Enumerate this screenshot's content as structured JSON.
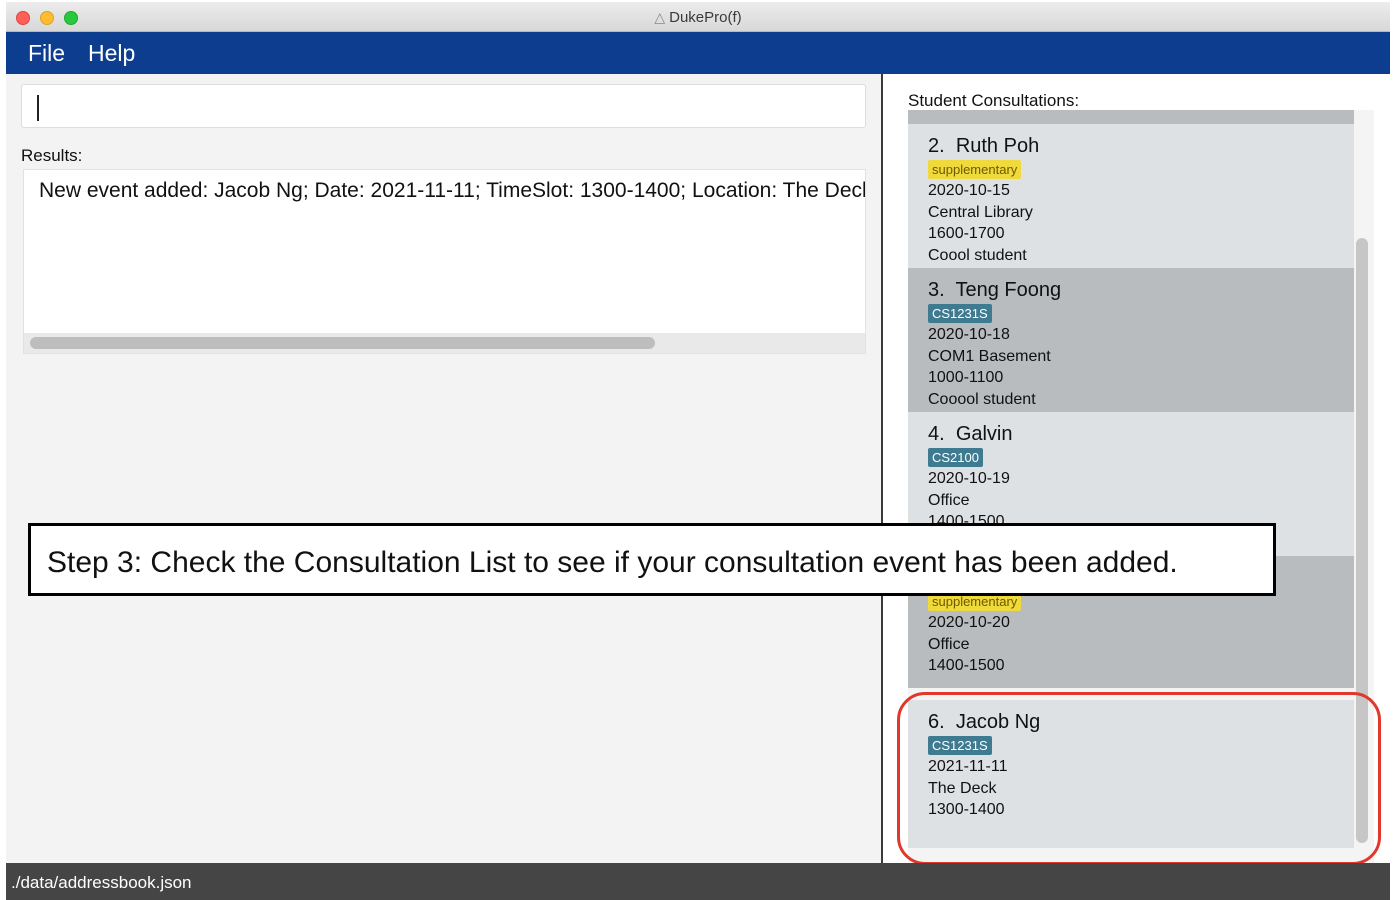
{
  "window": {
    "title": "DukePro(f)",
    "icon": "java-app-icon"
  },
  "menu": {
    "file": "File",
    "help": "Help"
  },
  "command": {
    "value": ""
  },
  "results": {
    "label": "Results:",
    "text": "New event added: Jacob Ng; Date: 2021-11-11; TimeSlot: 1300-1400; Location: The Deck"
  },
  "consultations": {
    "label": "Student Consultations:",
    "items": [
      {
        "index": "2.",
        "name": "Ruth Poh",
        "tag": "supplementary",
        "tag_color": "#f0d93a",
        "date": "2020-10-15",
        "location": "Central Library",
        "time": "1600-1700",
        "remark": "Coool student"
      },
      {
        "index": "3.",
        "name": "Teng Foong",
        "tag": "CS1231S",
        "tag_color": "#3e7b91",
        "date": "2020-10-18",
        "location": "COM1 Basement",
        "time": "1000-1100",
        "remark": "Cooool student"
      },
      {
        "index": "4.",
        "name": "Galvin",
        "tag": "CS2100",
        "tag_color": "#3e7b91",
        "date": "2020-10-19",
        "location": "Office",
        "time": "1400-1500"
      },
      {
        "tag": "supplementary",
        "tag_color": "#f0d93a",
        "date": "2020-10-20",
        "location": "Office",
        "time": "1400-1500"
      },
      {
        "index": "6.",
        "name": "Jacob Ng",
        "tag": "CS1231S",
        "tag_color": "#3e7b91",
        "date": "2021-11-11",
        "location": "The Deck",
        "time": "1300-1400"
      }
    ]
  },
  "status": {
    "path": "./data/addressbook.json"
  },
  "instruction": {
    "text": "Step 3: Check the Consultation List to see if your consultation event has been added."
  },
  "colors": {
    "menubar": "#0d3d8f",
    "highlight": "#e2372c",
    "card_light": "#dde1e4",
    "card_dark": "#b8bcbf",
    "statusbar": "#454545"
  }
}
